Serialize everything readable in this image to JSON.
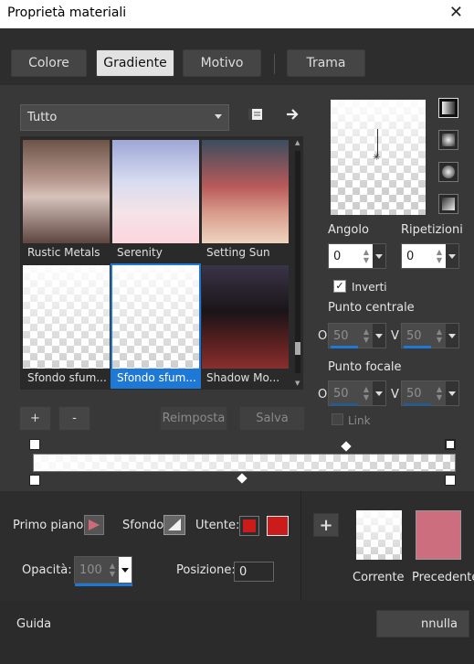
{
  "window": {
    "title": "Proprietà materiali",
    "close_icon": "close-icon"
  },
  "tabs": [
    {
      "label": "Colore"
    },
    {
      "label": "Gradiente"
    },
    {
      "label": "Motivo"
    },
    {
      "label": "Trama"
    }
  ],
  "category": {
    "value": "Tutto"
  },
  "gradients": [
    {
      "name": "Rustic Metals"
    },
    {
      "name": "Serenity"
    },
    {
      "name": "Setting Sun"
    },
    {
      "name": "Sfondo sfum..."
    },
    {
      "name": "Sfondo sfum..."
    },
    {
      "name": "Shadow Mo..."
    }
  ],
  "buttons": {
    "add": "+",
    "remove": "-",
    "reset": "Reimposta",
    "save": "Salva"
  },
  "angle": {
    "label": "Angolo",
    "value": "0"
  },
  "repeats": {
    "label": "Ripetizioni",
    "value": "0"
  },
  "invert": {
    "label": "Inverti",
    "checked": true
  },
  "center_point": {
    "label": "Punto centrale",
    "o_label": "O",
    "o_value": "50",
    "v_label": "V",
    "v_value": "50"
  },
  "focal_point": {
    "label": "Punto focale",
    "o_label": "O",
    "o_value": "50",
    "v_label": "V",
    "v_value": "50"
  },
  "link": {
    "label": "Link",
    "checked": false
  },
  "bottom": {
    "foreground_label": "Primo piano:",
    "background_label": "Sfondo:",
    "user_label": "Utente:",
    "user_color": "#cc1b1b",
    "opacity_label": "Opacità:",
    "opacity_value": "100",
    "position_label": "Posizione:",
    "position_value": "0",
    "current_label": "Corrente",
    "previous_label": "Precedente",
    "previous_color": "#cc6e7e",
    "add_icon": "plus-icon"
  },
  "footer": {
    "guide_label": "Guida",
    "cancel_label": "nnulla"
  },
  "colors": {
    "accent": "#1e78d6"
  }
}
